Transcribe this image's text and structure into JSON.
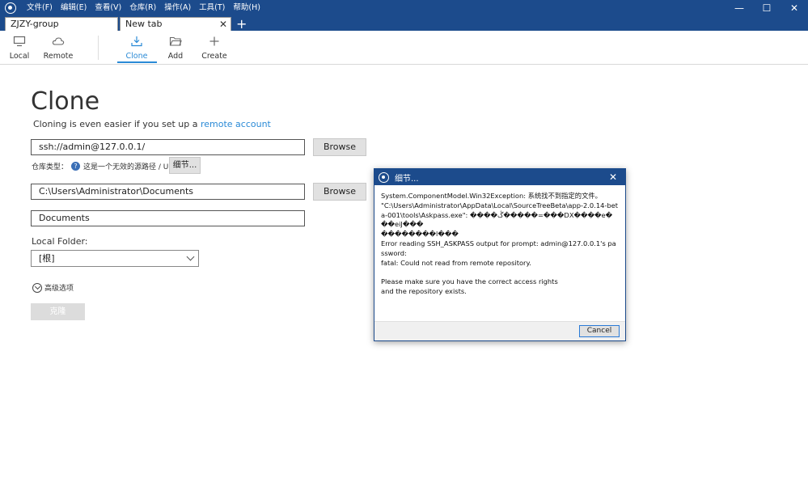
{
  "menu": [
    "文件(F)",
    "编辑(E)",
    "查看(V)",
    "仓库(R)",
    "操作(A)",
    "工具(T)",
    "帮助(H)"
  ],
  "window_controls": {
    "minimize": "—",
    "maximize": "☐",
    "close": "✕"
  },
  "tabs": [
    {
      "label": "ZJZY-group"
    },
    {
      "label": "New tab",
      "close": "✕"
    }
  ],
  "tab_add": "+",
  "toolbar": {
    "local": "Local",
    "remote": "Remote",
    "clone": "Clone",
    "add": "Add",
    "create": "Create"
  },
  "main": {
    "title": "Clone",
    "subtitle_prefix": "Cloning is even easier if you set up a ",
    "subtitle_link": "remote account",
    "source_url": "ssh://admin@127.0.0.1/",
    "browse_label": "Browse",
    "repo_type_label": "仓库类型：",
    "repo_type_help": "?",
    "repo_type_value": "这是一个无效的源路径 / URL",
    "detail_button": "细节...",
    "dest_path": "C:\\Users\\Administrator\\Documents",
    "name": "Documents",
    "local_folder_label": "Local Folder:",
    "local_folder_value": "[根]",
    "advanced_label": "高级选项",
    "clone_button": "克隆"
  },
  "dialog": {
    "title": "细节...",
    "close": "✕",
    "message": "System.ComponentModel.Win32Exception: 系统找不到指定的文件。\n\"C:\\Users\\Administrator\\AppData\\Local\\SourceTreeBeta\\app-2.0.14-beta-001\\tools\\Askpass.exe\": ����ڴ�����=���DX����e���eiJ���\n��������l���\nError reading SSH_ASKPASS output for prompt: admin@127.0.0.1's password:\nfatal: Could not read from remote repository.\n\nPlease make sure you have the correct access rights\nand the repository exists.",
    "cancel_label": "Cancel"
  },
  "colors": {
    "titlebar": "#1c4b8c",
    "accent": "#2a8ad6"
  }
}
